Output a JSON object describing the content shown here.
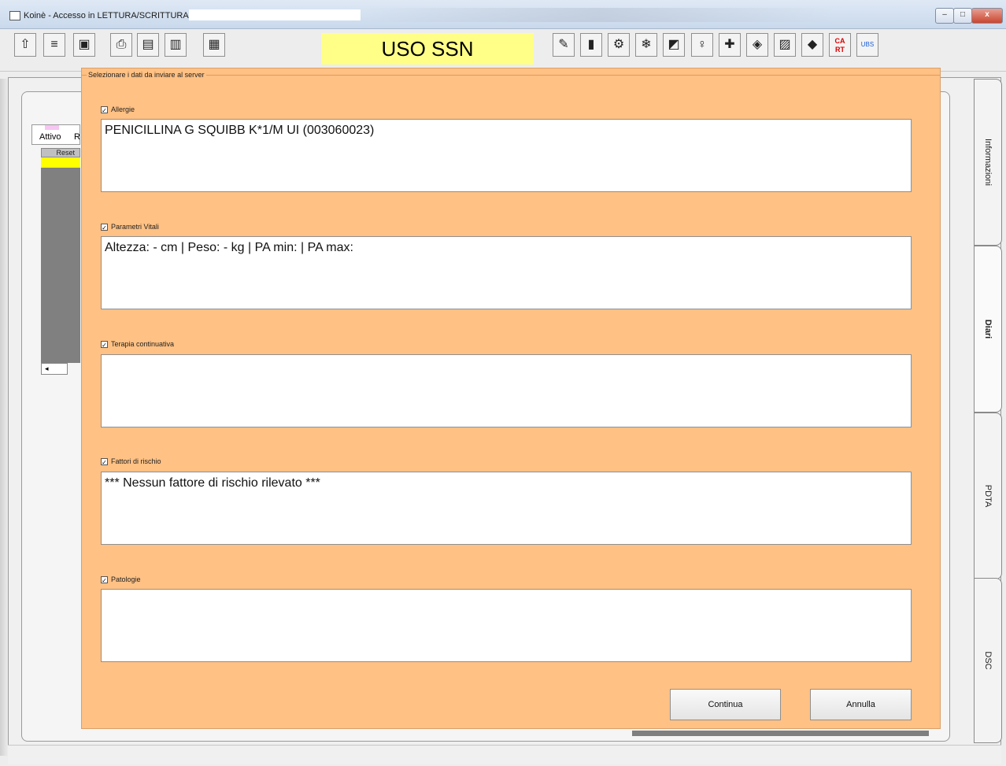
{
  "window": {
    "title": "Koinè - Accesso in LETTURA/SCRITTURA",
    "minimize": "–",
    "maximize": "□",
    "close": "x"
  },
  "toolbar": {
    "banner": "USO SSN",
    "left_icons": [
      "arrow-up-icon",
      "list-icon",
      "window-icon",
      "print-icon",
      "save-icon",
      "document-icon",
      "database-icon"
    ],
    "right_icons": [
      "tools-icon",
      "chart-icon",
      "handshake-icon",
      "snowflake-icon",
      "screen-icon",
      "person-icon",
      "pill-icon",
      "eye-icon",
      "clipboard-icon",
      "book-icon",
      "cart-icon",
      "ubs-icon"
    ],
    "cart_text": "CA RT",
    "ubs_text": "UBS"
  },
  "background": {
    "tab_attivo": "Attivo",
    "tab_r": "R",
    "grid_header": "Reset",
    "scroll_arrow": "◂"
  },
  "side_tabs": {
    "informazioni": "Informazioni",
    "diari": "Diari",
    "pdta": "PDTA",
    "dsc": "DSC"
  },
  "dialog": {
    "title": "Selezionare i dati da inviare al server",
    "sections": [
      {
        "label": "Allergie",
        "checked": true,
        "value": "PENICILLINA G SQUIBB K*1/M UI (003060023)"
      },
      {
        "label": "Parametri Vitali",
        "checked": true,
        "value": "Altezza:  - cm | Peso:  - kg | PA min:  | PA max:"
      },
      {
        "label": "Terapia continuativa",
        "checked": true,
        "value": ""
      },
      {
        "label": "Fattori di rischio",
        "checked": true,
        "value": "*** Nessun fattore di rischio rilevato ***"
      },
      {
        "label": "Patologie",
        "checked": true,
        "value": ""
      }
    ],
    "check_mark": "✓",
    "continue_label": "Continua",
    "cancel_label": "Annulla"
  }
}
